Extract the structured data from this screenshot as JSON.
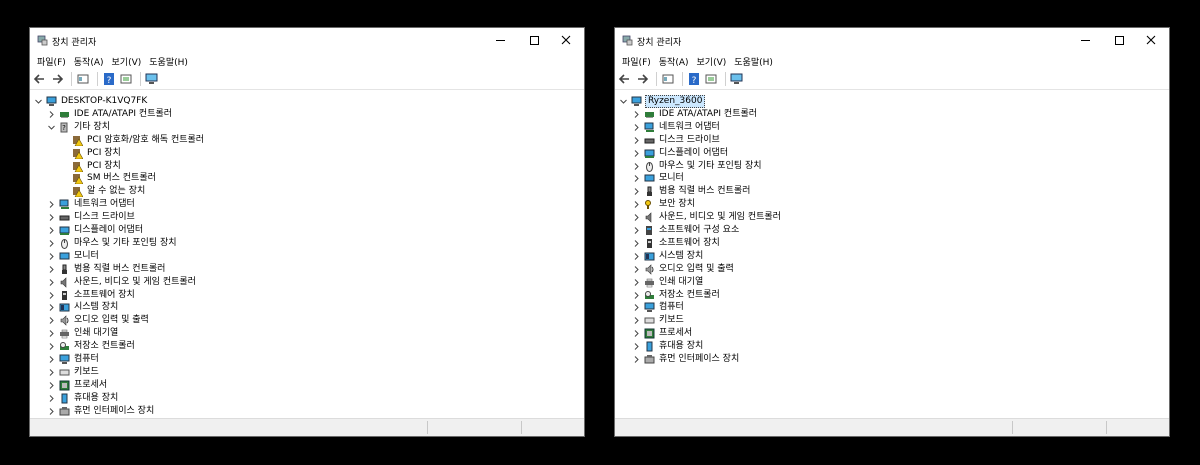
{
  "left": {
    "title": "장치 관리자",
    "menu": [
      "파일(F)",
      "동작(A)",
      "보기(V)",
      "도움말(H)"
    ],
    "tree": [
      {
        "label": "DESKTOP-K1VQ7FK",
        "icon": "computer-icon",
        "level": 0,
        "state": "expanded"
      },
      {
        "label": "IDE ATA/ATAPI 컨트롤러",
        "icon": "ide-controller-icon",
        "level": 1,
        "state": "collapsed"
      },
      {
        "label": "기타 장치",
        "icon": "unknown-device-icon",
        "level": 1,
        "state": "expanded"
      },
      {
        "label": "PCI 암호화/암호 해독 컨트롤러",
        "icon": "warning-device-icon",
        "level": 2,
        "state": "leaf"
      },
      {
        "label": "PCI 장치",
        "icon": "warning-device-icon",
        "level": 2,
        "state": "leaf"
      },
      {
        "label": "PCI 장치",
        "icon": "warning-device-icon",
        "level": 2,
        "state": "leaf"
      },
      {
        "label": "SM 버스 컨트롤러",
        "icon": "warning-device-icon",
        "level": 2,
        "state": "leaf"
      },
      {
        "label": "알 수 없는 장치",
        "icon": "warning-device-icon",
        "level": 2,
        "state": "leaf"
      },
      {
        "label": "네트워크 어댑터",
        "icon": "network-adapter-icon",
        "level": 1,
        "state": "collapsed"
      },
      {
        "label": "디스크 드라이브",
        "icon": "disk-drive-icon",
        "level": 1,
        "state": "collapsed"
      },
      {
        "label": "디스플레이 어댑터",
        "icon": "display-adapter-icon",
        "level": 1,
        "state": "collapsed"
      },
      {
        "label": "마우스 및 기타 포인팅 장치",
        "icon": "mouse-icon",
        "level": 1,
        "state": "collapsed"
      },
      {
        "label": "모니터",
        "icon": "monitor-icon",
        "level": 1,
        "state": "collapsed"
      },
      {
        "label": "범용 직렬 버스 컨트롤러",
        "icon": "usb-icon",
        "level": 1,
        "state": "collapsed"
      },
      {
        "label": "사운드, 비디오 및 게임 컨트롤러",
        "icon": "speaker-icon",
        "level": 1,
        "state": "collapsed"
      },
      {
        "label": "소프트웨어 장치",
        "icon": "software-device-icon",
        "level": 1,
        "state": "collapsed"
      },
      {
        "label": "시스템 장치",
        "icon": "system-device-icon",
        "level": 1,
        "state": "collapsed"
      },
      {
        "label": "오디오 입력 및 출력",
        "icon": "audio-icon",
        "level": 1,
        "state": "collapsed"
      },
      {
        "label": "인쇄 대기열",
        "icon": "printer-icon",
        "level": 1,
        "state": "collapsed"
      },
      {
        "label": "저장소 컨트롤러",
        "icon": "storage-controller-icon",
        "level": 1,
        "state": "collapsed"
      },
      {
        "label": "컴퓨터",
        "icon": "computer-icon",
        "level": 1,
        "state": "collapsed"
      },
      {
        "label": "키보드",
        "icon": "keyboard-icon",
        "level": 1,
        "state": "collapsed"
      },
      {
        "label": "프로세서",
        "icon": "processor-icon",
        "level": 1,
        "state": "collapsed"
      },
      {
        "label": "휴대용 장치",
        "icon": "portable-device-icon",
        "level": 1,
        "state": "collapsed"
      },
      {
        "label": "휴먼 인터페이스 장치",
        "icon": "hid-icon",
        "level": 1,
        "state": "collapsed"
      }
    ]
  },
  "right": {
    "title": "장치 관리자",
    "menu": [
      "파일(F)",
      "동작(A)",
      "보기(V)",
      "도움말(H)"
    ],
    "tree": [
      {
        "label": "Ryzen_3600",
        "icon": "computer-icon",
        "level": 0,
        "state": "expanded",
        "selected": true
      },
      {
        "label": "IDE ATA/ATAPI 컨트롤러",
        "icon": "ide-controller-icon",
        "level": 1,
        "state": "collapsed"
      },
      {
        "label": "네트워크 어댑터",
        "icon": "network-adapter-icon",
        "level": 1,
        "state": "collapsed"
      },
      {
        "label": "디스크 드라이브",
        "icon": "disk-drive-icon",
        "level": 1,
        "state": "collapsed"
      },
      {
        "label": "디스플레이 어댑터",
        "icon": "display-adapter-icon",
        "level": 1,
        "state": "collapsed"
      },
      {
        "label": "마우스 및 기타 포인팅 장치",
        "icon": "mouse-icon",
        "level": 1,
        "state": "collapsed"
      },
      {
        "label": "모니터",
        "icon": "monitor-icon",
        "level": 1,
        "state": "collapsed"
      },
      {
        "label": "범용 직렬 버스 컨트롤러",
        "icon": "usb-icon",
        "level": 1,
        "state": "collapsed"
      },
      {
        "label": "보안 장치",
        "icon": "security-device-icon",
        "level": 1,
        "state": "collapsed"
      },
      {
        "label": "사운드, 비디오 및 게임 컨트롤러",
        "icon": "speaker-icon",
        "level": 1,
        "state": "collapsed"
      },
      {
        "label": "소프트웨어 구성 요소",
        "icon": "software-component-icon",
        "level": 1,
        "state": "collapsed"
      },
      {
        "label": "소프트웨어 장치",
        "icon": "software-device-icon",
        "level": 1,
        "state": "collapsed"
      },
      {
        "label": "시스템 장치",
        "icon": "system-device-icon",
        "level": 1,
        "state": "collapsed"
      },
      {
        "label": "오디오 입력 및 출력",
        "icon": "audio-icon",
        "level": 1,
        "state": "collapsed"
      },
      {
        "label": "인쇄 대기열",
        "icon": "printer-icon",
        "level": 1,
        "state": "collapsed"
      },
      {
        "label": "저장소 컨트롤러",
        "icon": "storage-controller-icon",
        "level": 1,
        "state": "collapsed"
      },
      {
        "label": "컴퓨터",
        "icon": "computer-icon",
        "level": 1,
        "state": "collapsed"
      },
      {
        "label": "키보드",
        "icon": "keyboard-icon",
        "level": 1,
        "state": "collapsed"
      },
      {
        "label": "프로세서",
        "icon": "processor-icon",
        "level": 1,
        "state": "collapsed"
      },
      {
        "label": "휴대용 장치",
        "icon": "portable-device-icon",
        "level": 1,
        "state": "collapsed"
      },
      {
        "label": "휴먼 인터페이스 장치",
        "icon": "hid-icon",
        "level": 1,
        "state": "collapsed"
      }
    ]
  },
  "colors": {
    "selection": "#cce8ff",
    "monitor_blue": "#3aa0dc",
    "warning_yellow": "#f2c811"
  }
}
